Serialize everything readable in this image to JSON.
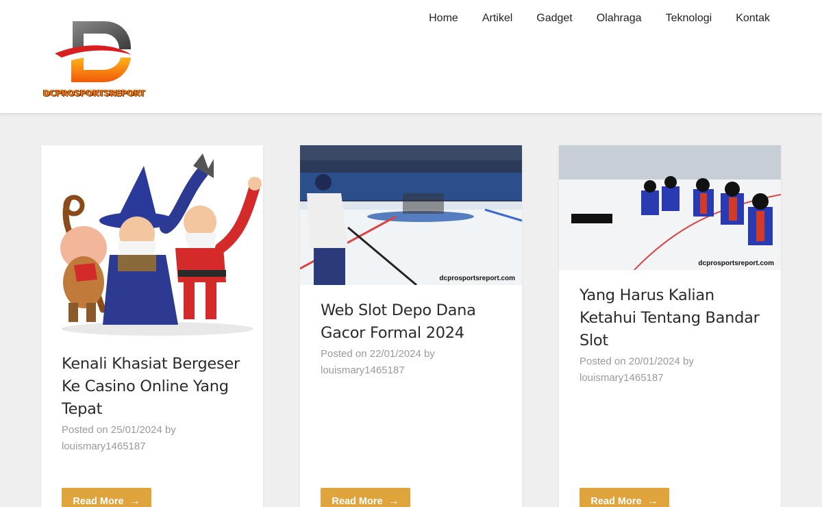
{
  "site": {
    "logo_text": "DCPROSPORTSREPORT"
  },
  "nav": {
    "items": [
      "Home",
      "Artikel",
      "Gadget",
      "Olahraga",
      "Teknologi",
      "Kontak"
    ]
  },
  "posts": [
    {
      "title": "Kenali Khasiat Bergeser Ke Casino Online Yang Tepat",
      "meta_prefix": "Posted on",
      "date": "25/01/2024",
      "by": "by",
      "author": "louismary1465187",
      "read_more": "Read More",
      "image_watermark": ""
    },
    {
      "title": "Web Slot Depo Dana Gacor Formal 2024",
      "meta_prefix": "Posted on",
      "date": "22/01/2024",
      "by": "by",
      "author": "louismary1465187",
      "read_more": "Read More",
      "image_watermark": "dcprosportsreport.com"
    },
    {
      "title": "Yang Harus Kalian Ketahui Tentang Bandar Slot",
      "meta_prefix": "Posted on",
      "date": "20/01/2024",
      "by": "by",
      "author": "louismary1465187",
      "read_more": "Read More",
      "image_watermark": "dcprosportsreport.com"
    }
  ],
  "colors": {
    "accent": "#e0a43c",
    "background": "#efefef",
    "meta_text": "#9a9a9a"
  },
  "icons": {
    "read_more": "arrow-right-icon"
  }
}
